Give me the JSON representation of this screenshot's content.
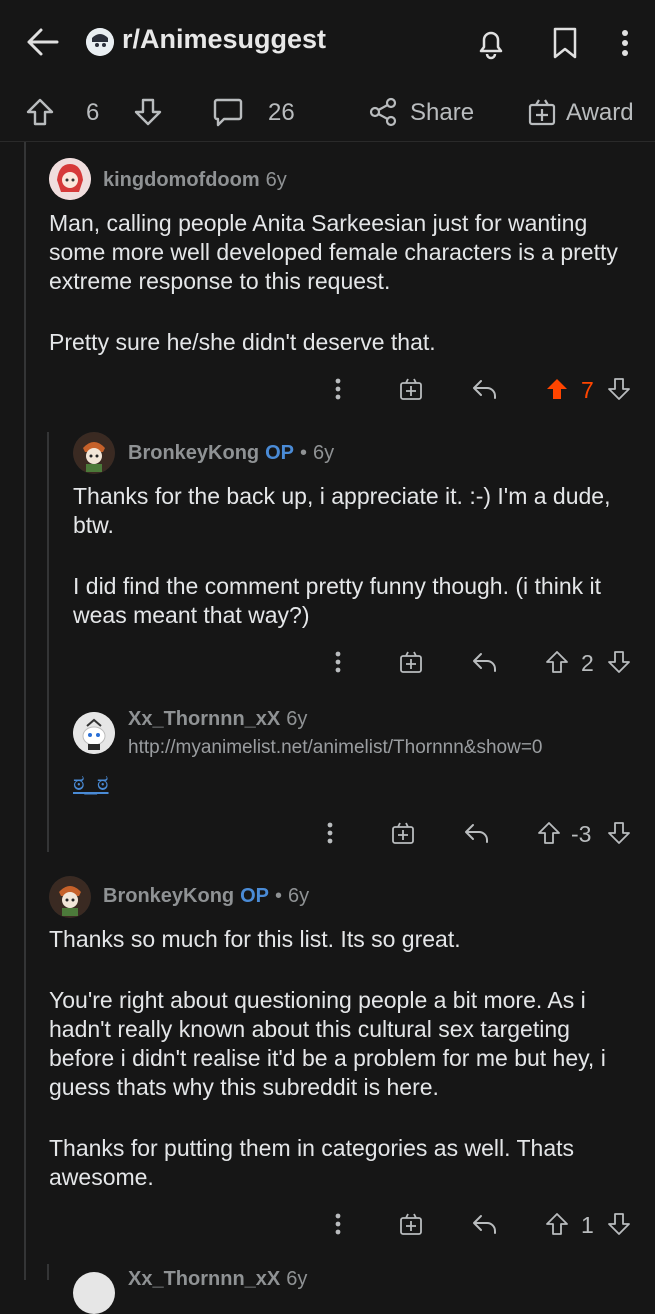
{
  "header": {
    "subreddit": "r/Animesuggest"
  },
  "post_actions": {
    "score": "6",
    "comments": "26",
    "share_label": "Share",
    "award_label": "Award"
  },
  "comments": [
    {
      "user": "kingdomofdoom",
      "age": "6y",
      "paragraphs": [
        "Man, calling people Anita Sarkeesian just for wanting some more well developed female characters is a pretty extreme response to this request.",
        "Pretty sure he/she didn't deserve that."
      ],
      "score": "7",
      "upvoted": true
    },
    {
      "user": "BronkeyKong",
      "op": "OP",
      "age": "6y",
      "paragraphs": [
        "Thanks for the back up, i appreciate it. :-) I'm a dude, btw.",
        "I did find the comment pretty funny though. (i think it weas meant that way?)"
      ],
      "score": "2"
    },
    {
      "user": "Xx_Thornnn_xX",
      "age": "6y",
      "flair": "http://myanimelist.net/animelist/Thornnn&show=0",
      "body": "ಠ_ಠ",
      "score": "-3"
    },
    {
      "user": "BronkeyKong",
      "op": "OP",
      "age": "6y",
      "paragraphs": [
        "Thanks so much for this list. Its so great.",
        "You're right about questioning people a bit more. As i hadn't really known about this cultural sex targeting before i didn't realise it'd be a problem for me but hey, i guess thats why this subreddit is here.",
        "Thanks for putting them in categories as well. Thats awesome."
      ],
      "score": "1"
    },
    {
      "user": "Xx_Thornnn_xX",
      "age": "6y"
    }
  ],
  "colors": {
    "background": "#161616",
    "upvote_active": "#ff4500",
    "op_badge": "#4a8bd6"
  }
}
